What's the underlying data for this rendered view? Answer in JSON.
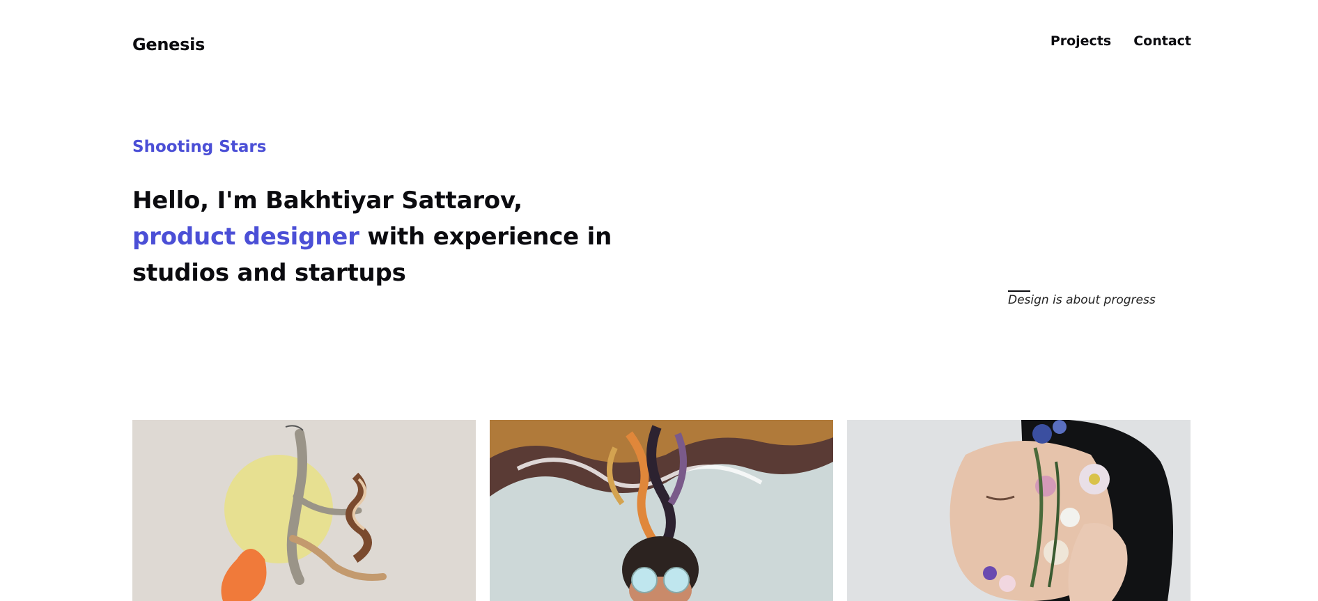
{
  "header": {
    "logo": "Genesis",
    "nav": [
      "Projects",
      "Contact"
    ]
  },
  "hero": {
    "eyebrow": "Shooting Stars",
    "headline_part1": "Hello, I'm Bakhtiyar Sattarov, ",
    "headline_accent": "product designer",
    "headline_part2": " with experience in studios and startups",
    "tagline": "Design is about progress"
  },
  "gallery": [
    {
      "name": "dancer-collage"
    },
    {
      "name": "smoke-hair-illustration"
    },
    {
      "name": "flower-face-portrait"
    }
  ],
  "colors": {
    "accent": "#4b4fd6",
    "text": "#0b0b0f",
    "background": "#ffffff"
  }
}
